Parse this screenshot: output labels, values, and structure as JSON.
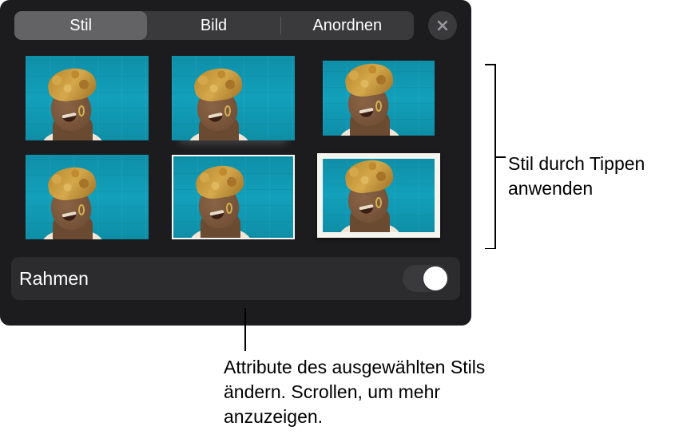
{
  "tabs": {
    "style": "Stil",
    "image": "Bild",
    "arrange": "Anordnen",
    "active": "style"
  },
  "frame": {
    "label": "Rahmen",
    "enabled": true
  },
  "callouts": {
    "apply_style": "Stil durch Tippen anwenden",
    "attributes": "Attribute des ausgewählten Stils ändern. Scrollen, um mehr anzuzeigen."
  },
  "styles": [
    {
      "name": "style-plain"
    },
    {
      "name": "style-reflection"
    },
    {
      "name": "style-small"
    },
    {
      "name": "style-plain-2"
    },
    {
      "name": "style-thin-border"
    },
    {
      "name": "style-thick-frame"
    }
  ]
}
